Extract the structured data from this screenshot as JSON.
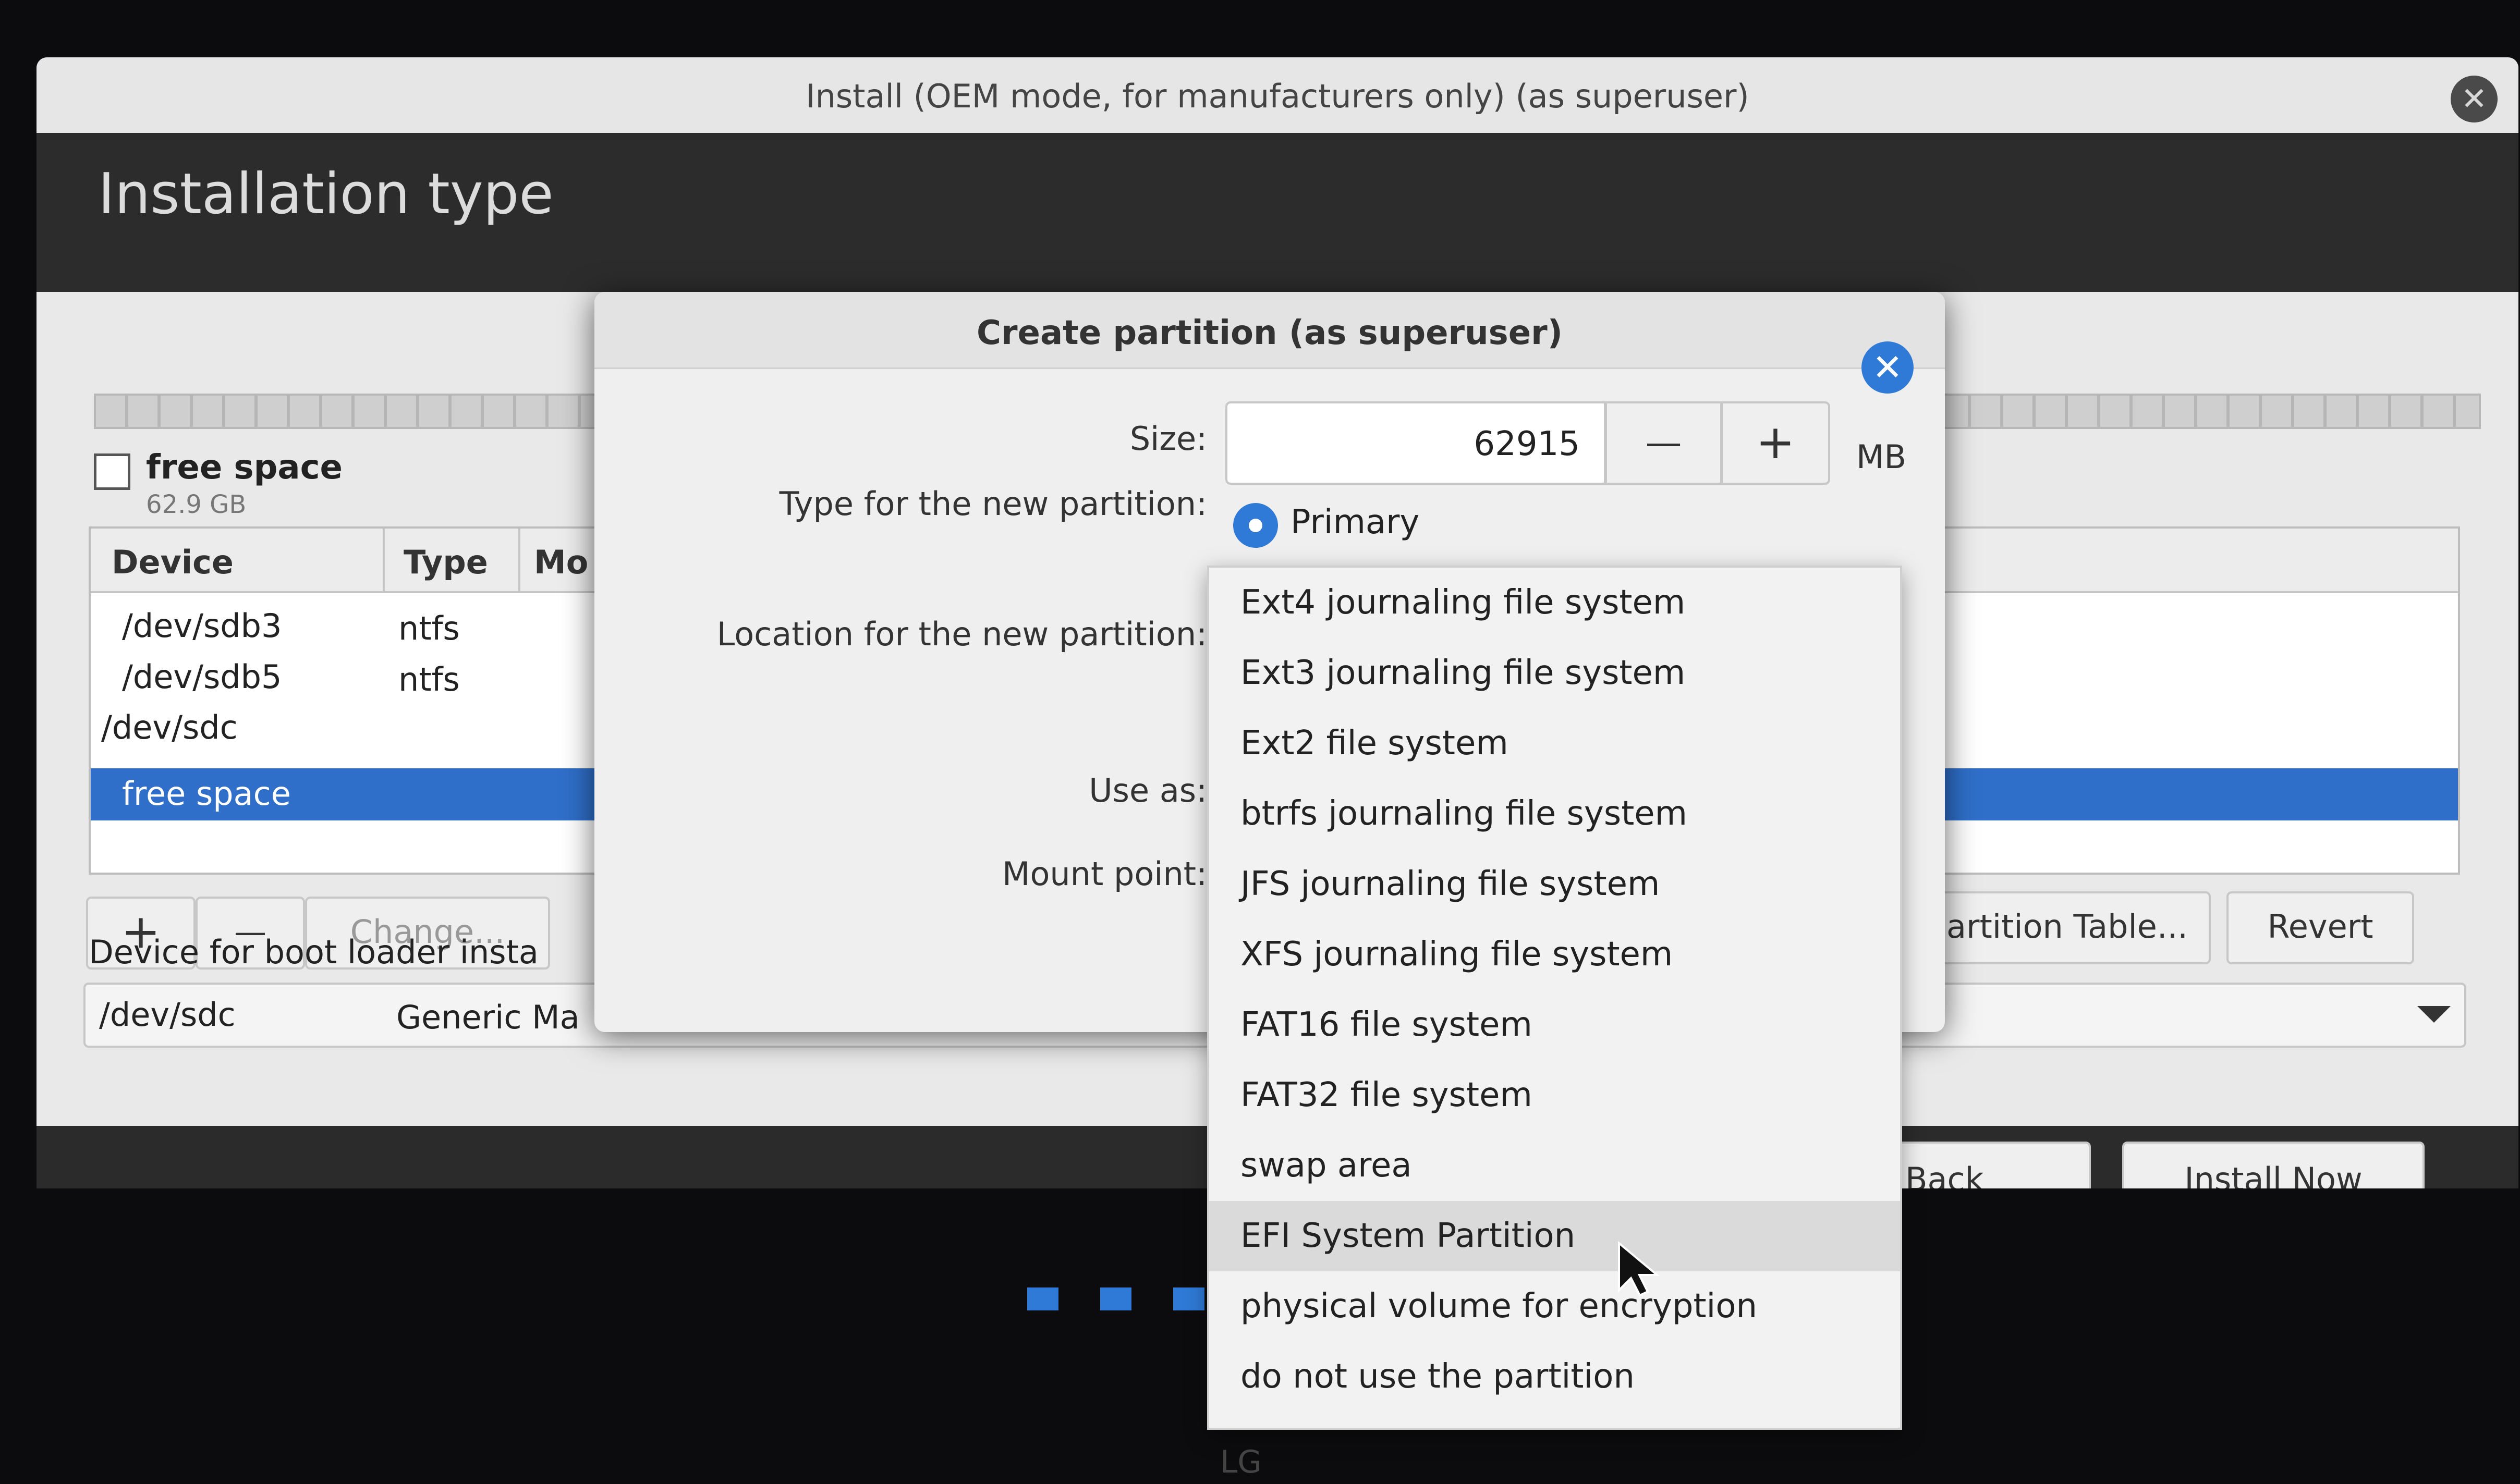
{
  "window": {
    "title": "Install (OEM mode, for manufacturers only) (as superuser)",
    "close_glyph": "✕",
    "page_title": "Installation type"
  },
  "partition_summary": {
    "label": "free space",
    "size": "62.9 GB"
  },
  "table": {
    "columns": [
      "Device",
      "Type",
      "Mo"
    ],
    "rows": [
      {
        "device": "/dev/sdb3",
        "type": "ntfs"
      },
      {
        "device": "/dev/sdb5",
        "type": "ntfs"
      },
      {
        "device": "/dev/sdc",
        "type": ""
      }
    ],
    "selected_row": "free space"
  },
  "toolbar": {
    "add_label": "+",
    "remove_label": "—",
    "change_label": "Change...",
    "new_table_label": "artition Table...",
    "revert_label": "Revert"
  },
  "boot_loader": {
    "label": "Device for boot loader insta",
    "device": "/dev/sdc",
    "model": "Generic Ma"
  },
  "nav": {
    "back_label": "Back",
    "install_label": "Install Now"
  },
  "dialog": {
    "title": "Create partition (as superuser)",
    "close_glyph": "✕",
    "size_label": "Size:",
    "size_value": "62915",
    "size_unit": "MB",
    "minus_label": "—",
    "plus_label": "+",
    "type_label": "Type for the new partition:",
    "type_value": "Primary",
    "location_label": "Location for the new partition:",
    "use_as_label": "Use as:",
    "mount_label": "Mount point:"
  },
  "dropdown": {
    "options": [
      "Ext4 journaling file system",
      "Ext3 journaling file system",
      "Ext2 file system",
      "btrfs journaling file system",
      "JFS journaling file system",
      "XFS journaling file system",
      "FAT16 file system",
      "FAT32 file system",
      "swap area",
      "EFI System Partition",
      "physical volume for encryption",
      "do not use the partition"
    ],
    "highlighted": "EFI System Partition"
  },
  "monitor": {
    "brand": "LG"
  },
  "colors": {
    "accent": "#2f7ad6",
    "selection": "#2f6fc9"
  }
}
